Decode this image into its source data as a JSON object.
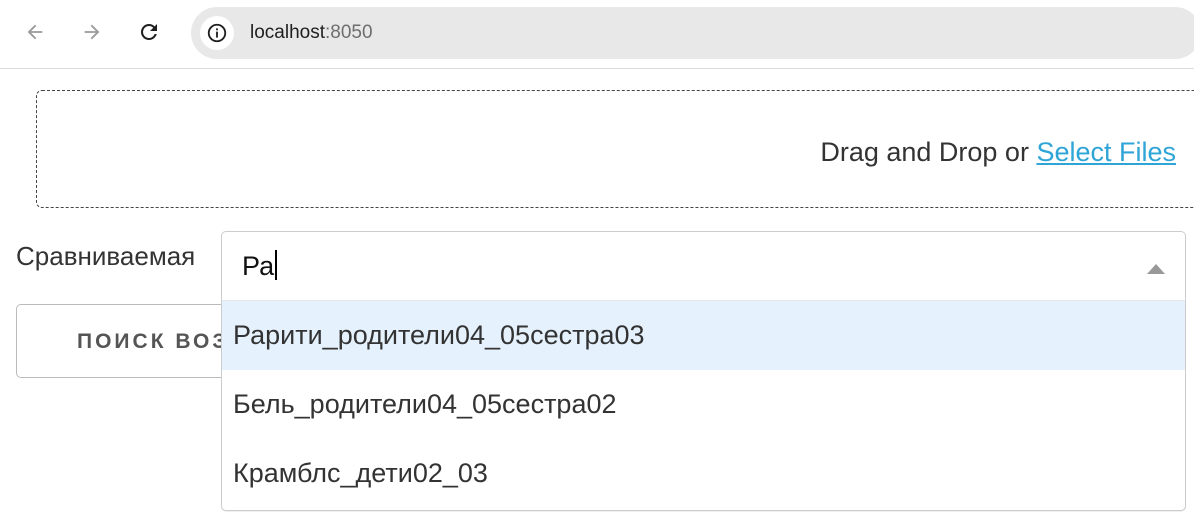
{
  "browser": {
    "url_host": "localhost",
    "url_port": ":8050"
  },
  "upload": {
    "text": "Drag and Drop or ",
    "link_label": "Select Files"
  },
  "form": {
    "label": "Сравниваемая",
    "search_button_label": "поиск воз"
  },
  "select": {
    "input_value": "Ра",
    "options": [
      "Рарити_родители04_05сестра03",
      "Бель_родители04_05сестра02",
      "Крамблс_дети02_03"
    ],
    "focused_index": 0
  },
  "colors": {
    "link": "#2fa4d6",
    "option_focus": "#e5f1fc"
  }
}
